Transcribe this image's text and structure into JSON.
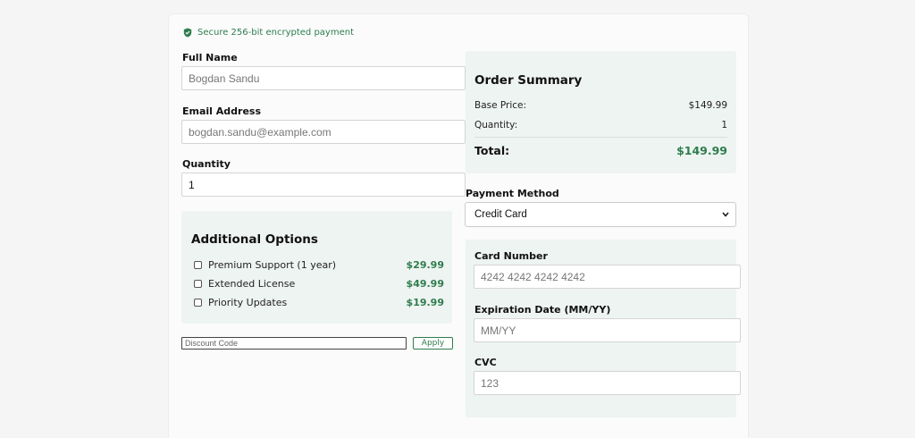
{
  "secure_notice": {
    "text": "Secure 256-bit encrypted payment",
    "icon": "shield-check-icon"
  },
  "customer": {
    "full_name_label": "Full Name",
    "full_name_placeholder": "Bogdan Sandu",
    "email_label": "Email Address",
    "email_placeholder": "bogdan.sandu@example.com",
    "quantity_label": "Quantity",
    "quantity_value": "1"
  },
  "additional_options": {
    "title": "Additional Options",
    "items": [
      {
        "label": "Premium Support (1 year)",
        "price": "$29.99",
        "checked": false
      },
      {
        "label": "Extended License",
        "price": "$49.99",
        "checked": false
      },
      {
        "label": "Priority Updates",
        "price": "$19.99",
        "checked": false
      }
    ]
  },
  "discount": {
    "placeholder": "Discount Code",
    "apply_label": "Apply"
  },
  "order_summary": {
    "title": "Order Summary",
    "base_price_label": "Base Price:",
    "base_price_value": "$149.99",
    "quantity_label": "Quantity:",
    "quantity_value": "1",
    "total_label": "Total:",
    "total_value": "$149.99"
  },
  "payment": {
    "method_label": "Payment Method",
    "method_selected": "Credit Card",
    "card_number_label": "Card Number",
    "card_number_placeholder": "4242 4242 4242 4242",
    "expiry_label": "Expiration Date (MM/YY)",
    "expiry_placeholder": "MM/YY",
    "cvc_label": "CVC",
    "cvc_placeholder": "123"
  },
  "colors": {
    "accent": "#2e7d4f",
    "panel_bg": "#eef4f1",
    "page_bg": "#f5f5f5"
  }
}
